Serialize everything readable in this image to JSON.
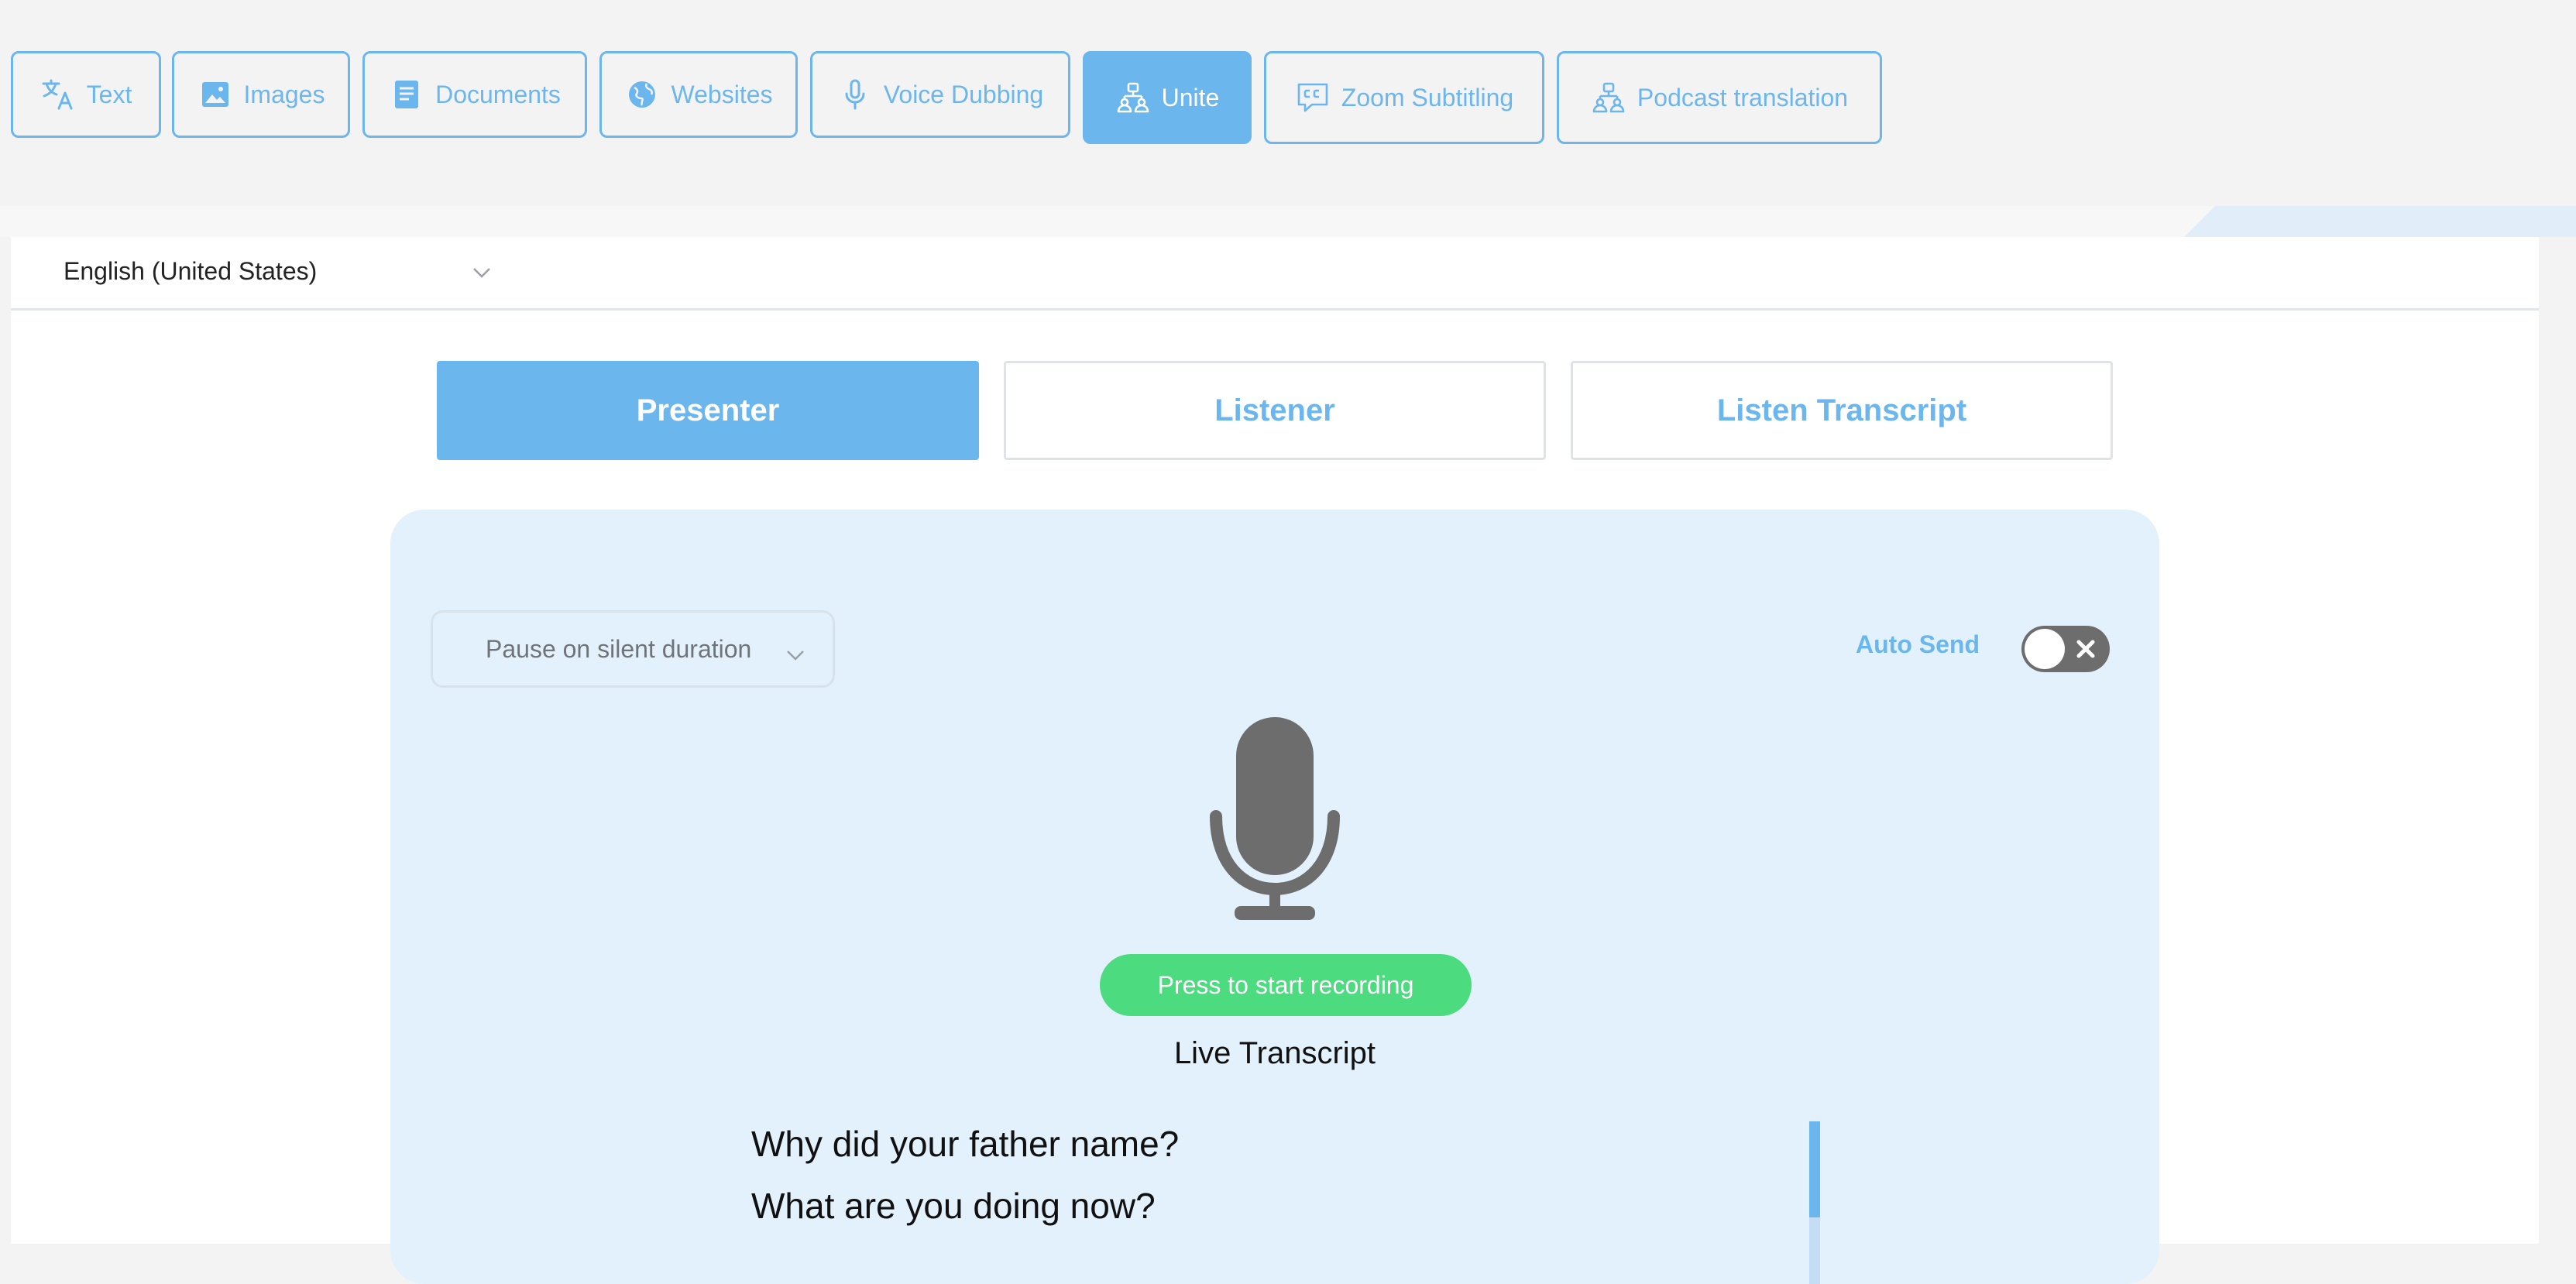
{
  "nav": {
    "items": [
      {
        "label": "Text",
        "icon": "translate-icon"
      },
      {
        "label": "Images",
        "icon": "image-icon"
      },
      {
        "label": "Documents",
        "icon": "document-icon"
      },
      {
        "label": "Websites",
        "icon": "globe-icon"
      },
      {
        "label": "Voice Dubbing",
        "icon": "microphone-icon"
      },
      {
        "label": "Unite",
        "icon": "users-network-icon",
        "active": true
      },
      {
        "label": "Zoom Subtitling",
        "icon": "closed-caption-icon"
      },
      {
        "label": "Podcast translation",
        "icon": "users-network-icon"
      }
    ]
  },
  "language": {
    "selected": "English (United States)"
  },
  "modes": {
    "items": [
      {
        "label": "Presenter",
        "active": true
      },
      {
        "label": "Listener"
      },
      {
        "label": "Listen Transcript"
      }
    ]
  },
  "controls": {
    "pause_option": "Pause on silent duration",
    "auto_send_label": "Auto Send",
    "auto_send_enabled": false,
    "record_button": "Press to start recording"
  },
  "transcript": {
    "title": "Live Transcript",
    "lines": [
      "Why did your father name?",
      "What are you doing now?"
    ]
  },
  "colors": {
    "accent": "#6cb6ee",
    "record": "#4cdb7e",
    "card_bg": "#e3f1fc",
    "toggle_off": "#6d6d6d"
  }
}
